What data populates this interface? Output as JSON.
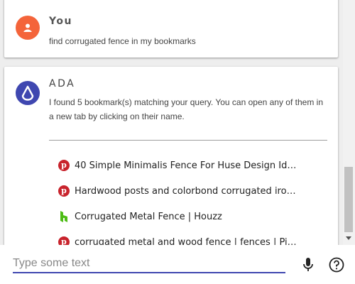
{
  "messages": {
    "user": {
      "sender": "You",
      "text": "find corrugated fence in my bookmarks",
      "avatar_icon": "person-icon",
      "avatar_color": "#f4643a"
    },
    "assistant": {
      "sender": "ADA",
      "text": "I found 5 bookmark(s) matching your query. You can open any of them in a new tab by clicking on their name.",
      "avatar_icon": "drop-icon",
      "avatar_color": "#3f47b0"
    }
  },
  "results": [
    {
      "label": "40 Simple Minimalis Fence For Huse Design Id…",
      "icon": "pinterest-icon"
    },
    {
      "label": "Hardwood posts and colorbond corrugated iro…",
      "icon": "pinterest-icon"
    },
    {
      "label": "Corrugated Metal Fence | Houzz",
      "icon": "houzz-icon"
    },
    {
      "label": "corrugated metal and wood fence | fences | Pi…",
      "icon": "pinterest-icon"
    }
  ],
  "input": {
    "placeholder": "Type some text",
    "value": ""
  },
  "colors": {
    "accent": "#3f47b0",
    "pinterest": "#c8232c",
    "houzz": "#4dbc15"
  }
}
